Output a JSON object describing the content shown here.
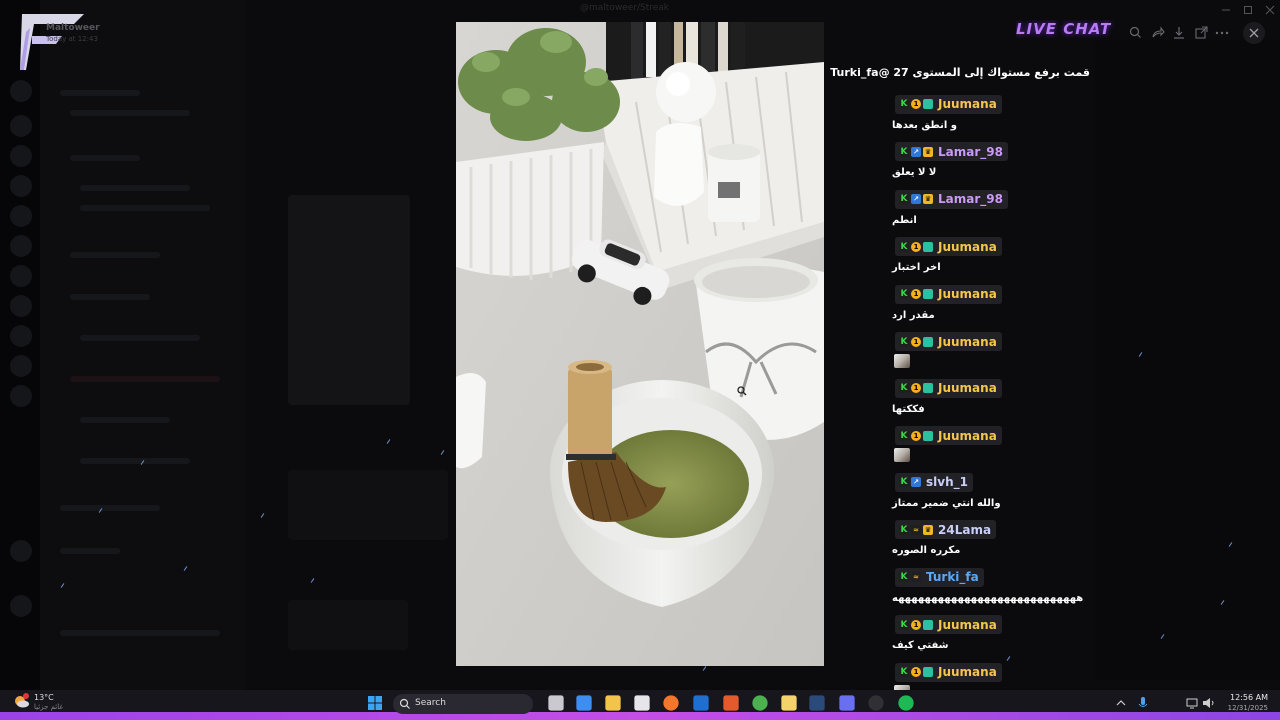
{
  "background_app": {
    "window_title": "@maltoweer/Streak",
    "user_name": "Maltoweer",
    "user_time": "Today at 12:43"
  },
  "colors": {
    "accent_purple": "#b67cf0",
    "taskbar_glow": "#c44ee6",
    "username_gold": "#f4c64a",
    "username_purple": "#c99af6",
    "username_blue": "#5aa8f6",
    "username_light": "#c9cff7"
  },
  "overlay": {
    "title": "LIVE CHAT",
    "toolbar": [
      "zoom-in-icon",
      "share-icon",
      "download-icon",
      "open-external-icon",
      "more-icon"
    ],
    "close_icon": "close-icon"
  },
  "chat": {
    "system_message": "قمت برفع مستواك إلى المستوى 27 @Turki_fa",
    "messages": [
      {
        "username": "Juumana",
        "color": "#f4c64a",
        "badges": [
          "k",
          "1",
          "g"
        ],
        "text": "و انطق بعدها"
      },
      {
        "username": "Lamar_98",
        "color": "#c99af6",
        "badges": [
          "k",
          "ar",
          "cr"
        ],
        "text": "لا لا يعلق"
      },
      {
        "username": "Lamar_98",
        "color": "#c99af6",
        "badges": [
          "k",
          "ar",
          "cr"
        ],
        "text": "انطم"
      },
      {
        "username": "Juumana",
        "color": "#f4c64a",
        "badges": [
          "k",
          "1",
          "g"
        ],
        "text": "اخر اختبار"
      },
      {
        "username": "Juumana",
        "color": "#f4c64a",
        "badges": [
          "k",
          "1",
          "g"
        ],
        "text": "مقدر ارد"
      },
      {
        "username": "Juumana",
        "color": "#f4c64a",
        "badges": [
          "k",
          "1",
          "g"
        ],
        "text": "",
        "image": "sticker-image"
      },
      {
        "username": "Juumana",
        "color": "#f4c64a",
        "badges": [
          "k",
          "1",
          "g"
        ],
        "text": "فككتها"
      },
      {
        "username": "Juumana",
        "color": "#f4c64a",
        "badges": [
          "k",
          "1",
          "g"
        ],
        "text": "",
        "image": "sticker-image"
      },
      {
        "username": "slvh_1",
        "color": "#c9cff7",
        "badges": [
          "k",
          "ar"
        ],
        "text": "والله انتي ضمير ممتاز"
      },
      {
        "username": "24Lama",
        "color": "#c9cff7",
        "badges": [
          "k",
          "ln",
          "cr"
        ],
        "text": "مكرره الصوره"
      },
      {
        "username": "Turki_fa",
        "color": "#5aa8f6",
        "badges": [
          "k",
          "ln"
        ],
        "text": "ههههههههههههههههههههههههههههه"
      },
      {
        "username": "Juumana",
        "color": "#f4c64a",
        "badges": [
          "k",
          "1",
          "g"
        ],
        "text": "شفتي كيف"
      },
      {
        "username": "Juumana",
        "color": "#f4c64a",
        "badges": [
          "k",
          "1",
          "g"
        ],
        "text": "",
        "image": "sticker-image"
      }
    ]
  },
  "taskbar": {
    "weather_temp": "13°C",
    "weather_desc": "غائم جزئيا",
    "search_placeholder": "Search",
    "time": "12:56 AM",
    "date": "12/31/2025",
    "apps": [
      "task-view-icon",
      "copilot-icon",
      "file-explorer-icon",
      "store-icon",
      "firefox-icon",
      "outlook-icon",
      "app-a-icon",
      "chrome-icon",
      "app-folder-icon",
      "steam-icon",
      "discord-icon",
      "obs-icon",
      "spotify-icon"
    ]
  }
}
